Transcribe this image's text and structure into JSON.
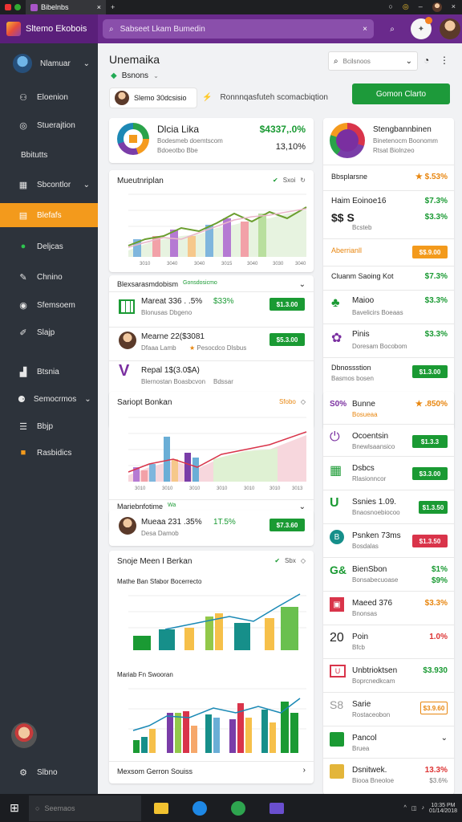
{
  "browser": {
    "tab_label": "Bibelnbs",
    "new_tab": "+"
  },
  "header": {
    "brand": "Sltemo Ekobois",
    "search_text": "Sabseet Lkam Bumedin",
    "search_clear": "×"
  },
  "sidebar": {
    "profile_label": "Nlamuar",
    "items": [
      {
        "label": "Eloenion",
        "icon": "person-icon"
      },
      {
        "label": "Stuerajtion",
        "icon": "help-icon"
      },
      {
        "label": "Bbitutts",
        "icon": ""
      },
      {
        "label": "Sbcontlor",
        "icon": "grid-icon"
      },
      {
        "label": "Blefafs",
        "icon": "table-icon"
      },
      {
        "label": "Deljcas",
        "icon": "status-icon"
      },
      {
        "label": "Chnino",
        "icon": "wrench-icon"
      },
      {
        "label": "Sfemsoem",
        "icon": "target-icon"
      },
      {
        "label": "Slajp",
        "icon": "brush-icon"
      },
      {
        "label": "Btsnia",
        "icon": "chart-icon"
      },
      {
        "label": "Semocrmos",
        "icon": "people-icon"
      },
      {
        "label": "Bbjp",
        "icon": "list-icon"
      },
      {
        "label": "Rasbidics",
        "icon": "square-icon"
      }
    ],
    "footer_label": "Slbno"
  },
  "page": {
    "title": "Unemaika",
    "subtitle": "Bsnons",
    "user_name": "Slemo 30dcsisio",
    "user_note": "Ronnnqasfuteh scomacbiqtion",
    "filter_placeholder": "Bcilsnoos",
    "action_button": "Gomon Clarto"
  },
  "summary": {
    "title": "Dlcia Lika",
    "sub1": "Bodesmeb doemtscom",
    "sub2": "Bdoeotbo Bbe",
    "value": "$4337,.0%",
    "pct": "13,10%"
  },
  "chart1": {
    "title": "Mueutnriplan",
    "link": "Sxoi",
    "xticks": [
      "3010",
      "3040",
      "3040",
      "3015",
      "3040",
      "3030",
      "3040"
    ]
  },
  "list1": {
    "title": "Blexsarasmdobism",
    "tag": "Gonsdosicmo",
    "items": [
      {
        "name": "Mareat 336 . .5%",
        "sub": "Blonusas Dbgeno",
        "value": "$33%",
        "btn": "$1.3.00"
      },
      {
        "name": "Mearne 22($3081",
        "sub": "Dfaaa Lamb",
        "note": "Pesocdco Dlsbus",
        "btn": "$5.3.00"
      },
      {
        "name": "Repal 1$(3.0$A)",
        "sub": "Blernostan Boasbcvon",
        "note": "Bdssar"
      }
    ]
  },
  "chart2": {
    "title": "Sariopt Bonkan",
    "link": "Sfobo",
    "xticks": [
      "3010",
      "3010",
      "3010",
      "3010",
      "3010",
      "3010",
      "3013"
    ]
  },
  "list2": {
    "title": "Mariebnfotime",
    "tag": "Wa",
    "item": {
      "name": "Mueaa 231 .35%",
      "sub": "Desa Damob",
      "value": "1T.5%",
      "btn": "$7.3.60"
    }
  },
  "chart3": {
    "title": "Snoje Meen I Berkan",
    "link": "Sbx",
    "sub_a": "Mathe Ban Sfabor Bocerrecto",
    "sub_b": "Mariab Fn Swooran",
    "footer": "Mexsom Gerron Souiss"
  },
  "right_top": {
    "title": "Stengbannbinen",
    "sub1": "Binetenocm Boonomm",
    "sub2": "Rtsat Biolnzeo",
    "rows": [
      {
        "label": "Bbsplarsne",
        "value": "$.53%",
        "style": "orange"
      },
      {
        "label": "Haim Eoinoe16",
        "value": "$7.3%",
        "style": "green"
      },
      {
        "label": "$$ S",
        "value": "$3.3%",
        "sub": "Bcsteb",
        "style": "green"
      },
      {
        "label": "Aberrianll",
        "btn": "$$.9.00",
        "style": "btn-orange"
      },
      {
        "label": "Cluanm Saoing Kot",
        "value": "$7.3%",
        "style": "green"
      },
      {
        "label": "Maioo",
        "sub": "Bavelicirs Boeaas",
        "value": "$3.3%",
        "style": "green"
      },
      {
        "label": "Pinis",
        "sub": "Doresam Bocobom",
        "value": "$3.3%",
        "style": "green"
      },
      {
        "label": "Dbnossstion",
        "sub": "Basmos bosen",
        "btn": "$1.3.00",
        "style": "btn-green"
      }
    ]
  },
  "right_bottom": {
    "rows": [
      {
        "label": "Bunne",
        "lead": "S0%",
        "sub": "Bosueaa",
        "value": ".850%",
        "style": "orange"
      },
      {
        "label": "Ocoentsin",
        "sub": "Bnewlsaansico",
        "btn": "$1.3.3",
        "style": "btn-green"
      },
      {
        "label": "Dsbcs",
        "sub": "Rlasionncor",
        "btn": "$3.3.00",
        "style": "btn-green"
      },
      {
        "label": "Ssnies 1.09.",
        "sub": "Bnaosnoebiocoo",
        "btn": "$1.3.50",
        "style": "btn-green"
      },
      {
        "label": "Psnken 73ms",
        "sub": "Bosdalas",
        "btn": "$1.3.50",
        "style": "btn-red"
      },
      {
        "label": "BienSbon",
        "sub": "Bonsabecuoase",
        "value": "$1%",
        "value2": "$9%",
        "style": "green"
      },
      {
        "label": "Maeed 376",
        "sub": "Bnonsas",
        "value": "$3.3%",
        "style": "orange"
      },
      {
        "label": "Poin",
        "lead": "20",
        "sub": "Bfcb",
        "value": "1.0%",
        "style": "red"
      },
      {
        "label": "Unbtrioktsen",
        "sub": "Boprcnedkcam",
        "value": "$3.930",
        "style": "green"
      },
      {
        "label": "Sarie",
        "sub": "Rostaceobon",
        "btn": "$3.9.60",
        "style": "btn-orange-outline"
      },
      {
        "label": "Pancol",
        "sub": "Bruea",
        "style": "chevron"
      },
      {
        "label": "Dsnitwek.",
        "sub": "Biooa Bneoloe",
        "value": "13.3%",
        "value2": "$3.6%",
        "style": "red"
      }
    ]
  },
  "taskbar": {
    "search": "Seemaos",
    "clock": "10:35 PM",
    "date": "01/14/2018"
  }
}
